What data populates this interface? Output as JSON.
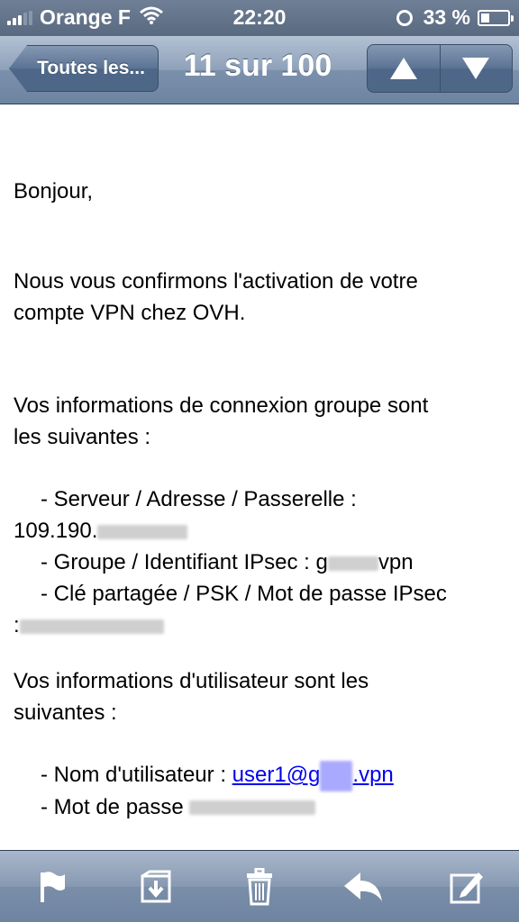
{
  "status": {
    "carrier": "Orange F",
    "time": "22:20",
    "battery_text": "33 %",
    "battery_level": 0.33
  },
  "nav": {
    "back_label": "Toutes les...",
    "title": "11 sur 100",
    "prev_icon": "arrow-up-icon",
    "next_icon": "arrow-down-icon"
  },
  "email": {
    "greeting": "Bonjour,",
    "para1_line1": "Nous vous confirmons l'activation de votre",
    "para1_line2": "compte VPN chez OVH.",
    "para2_line1": "Vos informations de connexion groupe sont",
    "para2_line2": "les suivantes :",
    "server_label": "- Serveur / Adresse / Passerelle :",
    "server_value": "109.190.",
    "group_label": "- Groupe / Identifiant IPsec : g",
    "group_suffix": "vpn",
    "psk_label": "- Clé partagée / PSK / Mot de passe IPsec",
    "psk_prefix": ":",
    "para3_line1": "Vos informations d'utilisateur sont les",
    "para3_line2": "suivantes :",
    "username_label": "- Nom d'utilisateur :",
    "username_link_a": "user1@g",
    "username_link_b": ".vpn",
    "password_label": "- Mot de passe"
  },
  "toolbar": {
    "icons": [
      "flag-icon",
      "move-folder-icon",
      "trash-icon",
      "reply-icon",
      "compose-icon"
    ]
  },
  "colors": {
    "bar_blue": "#6d84a2",
    "link": "#0000ee"
  }
}
